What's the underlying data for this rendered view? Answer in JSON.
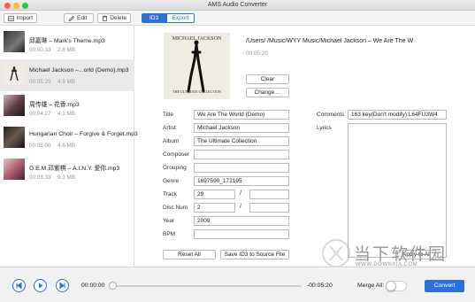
{
  "window": {
    "title": "AMS Audio Converter",
    "traffic_colors": [
      "#fc5f57",
      "#fdbc2e",
      "#28c840"
    ]
  },
  "toolbar": {
    "import_label": "Import",
    "edit_label": "Edit",
    "delete_label": "Delete",
    "tab_id3": "ID3",
    "tab_export": "Export",
    "accent": "#2e6fd8"
  },
  "files": [
    {
      "name": "邱嘉琳 – Mark's Theme.mp3",
      "duration": "00:00:33",
      "size": "2.6 MB",
      "selected": false
    },
    {
      "name": "Michael Jackson –...orld (Demo).mp3",
      "duration": "00:05:20",
      "size": "4.9 MB",
      "selected": true
    },
    {
      "name": "周传雄 – 花香.mp3",
      "duration": "00:04:27",
      "size": "4.1 MB",
      "selected": false
    },
    {
      "name": "Hungarian Choir – Forgive & Forget.mp3",
      "duration": "00:05:00",
      "size": "4.6 MB",
      "selected": false
    },
    {
      "name": "G.E.M.邓紫棋 – A.I.N.Y. 爱你.mp3",
      "duration": "00:03:33",
      "size": "9.3 MB",
      "selected": false
    }
  ],
  "detail": {
    "path": "/Users/        /Music/WYY Music/Michael Jackson – We Are The W",
    "duration": "00:05:20",
    "cover_text": {
      "artist": "MICHAEL JACKSON",
      "album": "THE ULTIMATE COLLECTION"
    },
    "clear_label": "Clear",
    "change_label": "Change ..."
  },
  "tags": {
    "title_label": "Title",
    "title_value": "We Are The World (Demo)",
    "artist_label": "Artist",
    "artist_value": "Michael Jackson",
    "album_label": "Album",
    "album_value": "The Ultimate Collection",
    "composer_label": "Composer",
    "composer_value": "",
    "grouping_label": "Grouping",
    "grouping_value": "",
    "genre_label": "Genre",
    "genre_value": "1697590_172195",
    "track_label": "Track",
    "track_value": "29",
    "track_total": "",
    "disc_label": "Disc Num",
    "disc_value": "2",
    "disc_total": "",
    "year_label": "Year",
    "year_value": "2009",
    "bpm_label": "BPM",
    "bpm_value": "",
    "comments_label": "Comments",
    "comments_value": "163 key(Don't modify):L64FU3W4",
    "lyrics_label": "Lyrics",
    "slash": "/"
  },
  "actions": {
    "reset_label": "Reset All",
    "save_label": "Save ID3 to Source File",
    "apply_label": "Apply to All"
  },
  "player": {
    "current_time": "00:00:00",
    "remaining_time": "-00:05:20",
    "merge_label": "Merge All:",
    "convert_label": "Convert",
    "progress": 0
  },
  "watermark": {
    "text": "当下软件园",
    "url": "WWW.DOWNXIA.COM"
  }
}
